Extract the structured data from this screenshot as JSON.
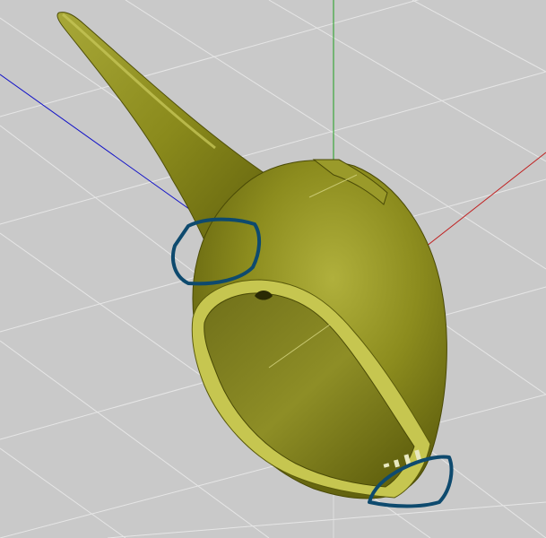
{
  "viewport": {
    "name": "3d-model-viewport",
    "background_color": "#c9c9c9",
    "grid_color": "#e6e6e6"
  },
  "axes": {
    "x_axis_color": "#c02020",
    "y_axis_color": "#20a020",
    "z_axis_color": "#1010c8"
  },
  "model": {
    "name": "helmet-mesh",
    "color": "#8f8f1c",
    "highlight_color": "#b8b84a",
    "shadow_color": "#4a4a08"
  },
  "annotations": {
    "color": "#0e4a6e",
    "items": [
      {
        "name": "annotation-circle-crest-joint"
      },
      {
        "name": "annotation-circle-chin-edge"
      }
    ]
  }
}
